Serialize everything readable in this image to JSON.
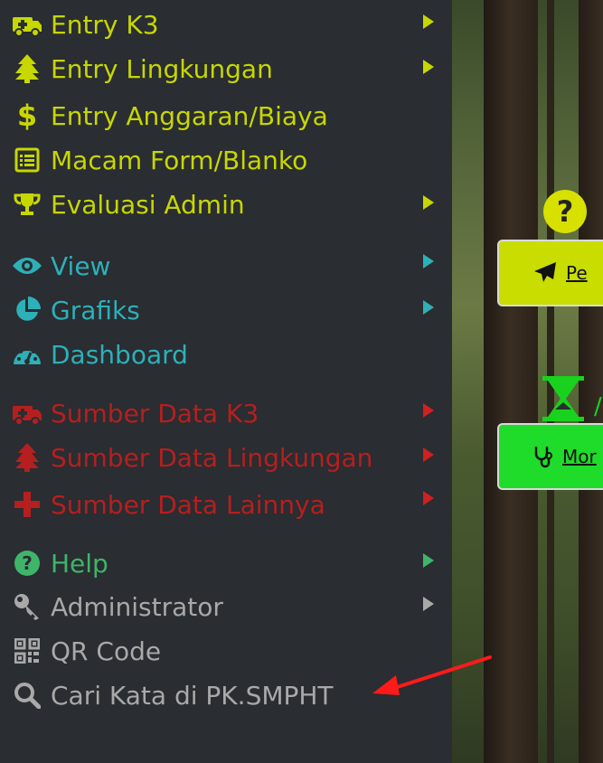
{
  "menu": {
    "items": [
      {
        "label": "Entry K3",
        "icon": "ambulance-icon",
        "glyph": "🚑",
        "color": "#c7d700",
        "has_submenu": true
      },
      {
        "label": "Entry Lingkungan",
        "icon": "tree-icon",
        "glyph": "🌲",
        "color": "#c7d700",
        "has_submenu": true
      },
      {
        "label": "Entry Anggaran/Biaya",
        "icon": "dollar-icon",
        "glyph": "$",
        "color": "#c7d700",
        "has_submenu": false
      },
      {
        "label": "Macam Form/Blanko",
        "icon": "form-icon",
        "glyph": "☰",
        "color": "#c7d700",
        "has_submenu": false
      },
      {
        "label": "Evaluasi Admin",
        "icon": "trophy-icon",
        "glyph": "🏆",
        "color": "#c7d700",
        "has_submenu": true
      },
      {
        "label": "View",
        "icon": "eye-icon",
        "glyph": "👁",
        "color": "#2db0b8",
        "has_submenu": true
      },
      {
        "label": "Grafiks",
        "icon": "pie-chart-icon",
        "glyph": "◔",
        "color": "#2db0b8",
        "has_submenu": true
      },
      {
        "label": "Dashboard",
        "icon": "dashboard-gauge-icon",
        "glyph": "◉",
        "color": "#2db0b8",
        "has_submenu": false
      },
      {
        "label": "Sumber Data K3",
        "icon": "ambulance-icon",
        "glyph": "🚑",
        "color": "#b51f1f",
        "has_submenu": true
      },
      {
        "label": "Sumber Data Lingkungan",
        "icon": "tree-icon",
        "glyph": "🌲",
        "color": "#b51f1f",
        "has_submenu": true
      },
      {
        "label": "Sumber Data Lainnya",
        "icon": "plus-icon",
        "glyph": "✚",
        "color": "#b51f1f",
        "has_submenu": true
      },
      {
        "label": "Help",
        "icon": "question-circle-icon",
        "glyph": "?",
        "color": "#3fb56a",
        "has_submenu": true
      },
      {
        "label": "Administrator",
        "icon": "key-icon",
        "glyph": "🔑",
        "color": "#a9a9a9",
        "has_submenu": true
      },
      {
        "label": "QR Code",
        "icon": "qr-code-icon",
        "glyph": "▦",
        "color": "#a9a9a9",
        "has_submenu": false
      },
      {
        "label": "Cari Kata di PK.SMPHT",
        "icon": "search-icon",
        "glyph": "⌕",
        "color": "#a9a9a9",
        "has_submenu": false
      }
    ]
  },
  "background_panel": {
    "button1_label": "Pe",
    "button1_icon": "paper-plane-icon",
    "button1_color": "#c9dd00",
    "button2_label": "Mor",
    "button2_icon": "stethoscope-icon",
    "button2_color": "#1fdc2a",
    "question_icon": "question-circle-icon",
    "hourglass_icon": "hourglass-icon",
    "hourglass_letter": "/"
  },
  "annotation": {
    "arrow_color": "#ff1a1a"
  }
}
